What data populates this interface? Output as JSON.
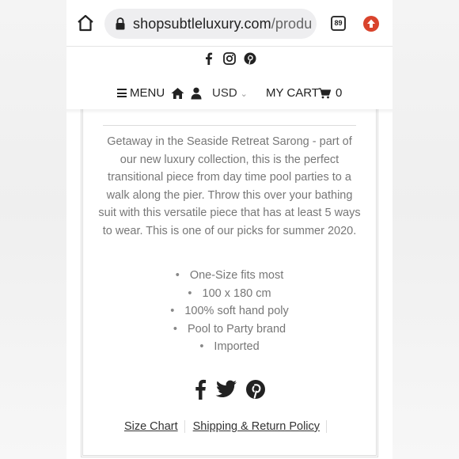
{
  "browser": {
    "url_domain": "shopsubtleluxury.com",
    "url_path": "/produ",
    "tab_count": "89",
    "icons": [
      "home-icon",
      "lock-icon",
      "tabs-icon",
      "extension-icon"
    ],
    "extension_color": "#d9432c"
  },
  "header": {
    "social_icons": [
      "facebook-icon",
      "instagram-icon",
      "pinterest-icon"
    ],
    "menu_label": "MENU",
    "currency": "USD",
    "cart_label": "MY CART",
    "cart_count": "0"
  },
  "product": {
    "description": "Getaway in the Seaside Retreat Sarong - part of our new luxury collection, this is the perfect transitional piece from day time pool parties to a walk along the pier. Throw this over your bathing suit with this versatile piece that has at least 5 ways to wear. This is one of our picks for summer 2020.",
    "features": [
      "One-Size fits most",
      "100 x 180 cm",
      "100% soft hand poly",
      "Pool to Party brand",
      "Imported"
    ],
    "bullet": "•"
  },
  "share": {
    "icons": [
      "facebook-icon",
      "twitter-icon",
      "pinterest-icon"
    ]
  },
  "links": {
    "size_chart": "Size Chart",
    "shipping": "Shipping & Return Policy"
  }
}
